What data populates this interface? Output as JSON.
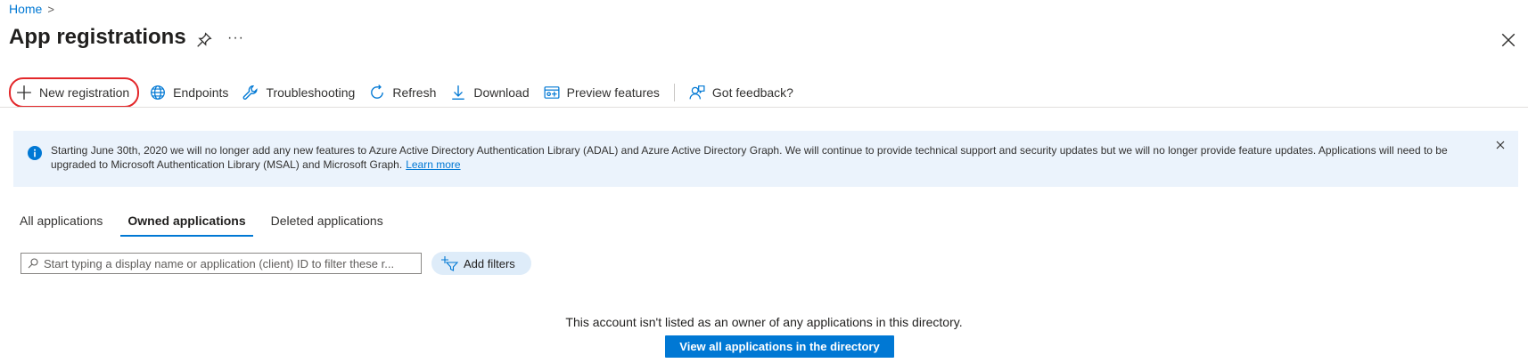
{
  "breadcrumb": {
    "home": "Home",
    "separator": ">"
  },
  "page": {
    "title": "App registrations",
    "more": "···"
  },
  "toolbar": {
    "new_registration": "New registration",
    "endpoints": "Endpoints",
    "troubleshooting": "Troubleshooting",
    "refresh": "Refresh",
    "download": "Download",
    "preview_features": "Preview features",
    "feedback": "Got feedback?"
  },
  "banner": {
    "message": "Starting June 30th, 2020 we will no longer add any new features to Azure Active Directory Authentication Library (ADAL) and Azure Active Directory Graph. We will continue to provide technical support and security updates but we will no longer provide feature updates. Applications will need to be upgraded to Microsoft Authentication Library (MSAL) and Microsoft Graph.",
    "link": "Learn more"
  },
  "tabs": [
    {
      "label": "All applications",
      "active": false
    },
    {
      "label": "Owned applications",
      "active": true
    },
    {
      "label": "Deleted applications",
      "active": false
    }
  ],
  "filter": {
    "placeholder": "Start typing a display name or application (client) ID to filter these r...",
    "add_filters": "Add filters"
  },
  "empty_state": {
    "message": "This account isn't listed as an owner of any applications in this directory.",
    "button": "View all applications in the directory"
  },
  "colors": {
    "accent": "#0078d4",
    "highlight": "#e3272a",
    "banner_bg": "#ebf3fc"
  }
}
